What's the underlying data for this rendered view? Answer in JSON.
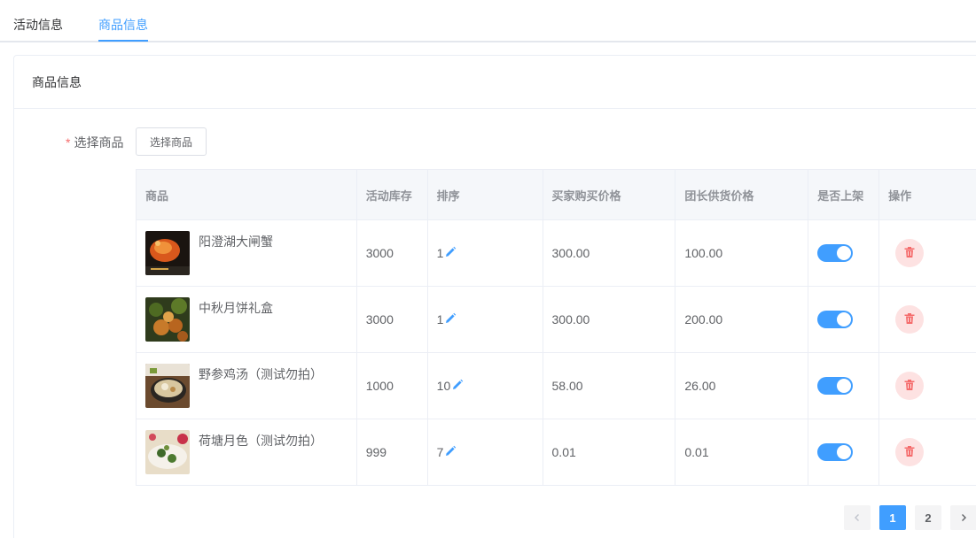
{
  "tabs": [
    {
      "label": "活动信息",
      "active": false
    },
    {
      "label": "商品信息",
      "active": true
    }
  ],
  "card": {
    "title": "商品信息"
  },
  "form": {
    "required_mark": "*",
    "label": "选择商品",
    "select_button": "选择商品"
  },
  "table": {
    "headers": [
      "商品",
      "活动库存",
      "排序",
      "买家购买价格",
      "团长供货价格",
      "是否上架",
      "操作"
    ],
    "rows": [
      {
        "name": "阳澄湖大闸蟹",
        "stock": "3000",
        "sort": "1",
        "buy_price": "300.00",
        "supply_price": "100.00",
        "on_shelf": true
      },
      {
        "name": "中秋月饼礼盒",
        "stock": "3000",
        "sort": "1",
        "buy_price": "300.00",
        "supply_price": "200.00",
        "on_shelf": true
      },
      {
        "name": "野参鸡汤（测试勿拍）",
        "stock": "1000",
        "sort": "10",
        "buy_price": "58.00",
        "supply_price": "26.00",
        "on_shelf": true
      },
      {
        "name": "荷塘月色（测试勿拍）",
        "stock": "999",
        "sort": "7",
        "buy_price": "0.01",
        "supply_price": "0.01",
        "on_shelf": true
      }
    ]
  },
  "pagination": {
    "pages": [
      "1",
      "2"
    ],
    "current": "1"
  },
  "colors": {
    "accent": "#409eff",
    "danger": "#f56c6c",
    "danger_bg": "#fde2e2"
  }
}
